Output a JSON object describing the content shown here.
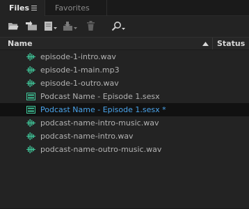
{
  "tabs": {
    "files_label": "Files",
    "favorites_label": "Favorites"
  },
  "toolbar": {
    "icons": [
      "open-folder-icon",
      "import-icon",
      "new-file-dropdown-icon",
      "insert-dropdown-icon",
      "delete-icon",
      "search-dropdown-icon"
    ]
  },
  "list": {
    "name_header": "Name",
    "status_header": "Status",
    "sort_direction": "ascending",
    "files": [
      {
        "label": "episode-1-intro.wav",
        "icon": "waveform-icon",
        "selected": false
      },
      {
        "label": "episode-1-main.mp3",
        "icon": "waveform-icon",
        "selected": false
      },
      {
        "label": "episode-1-outro.wav",
        "icon": "waveform-icon",
        "selected": false
      },
      {
        "label": "Podcast Name - Episode 1.sesx",
        "icon": "multitrack-session-icon",
        "selected": false
      },
      {
        "label": "Podcast Name - Episode 1.sesx *",
        "icon": "multitrack-session-icon",
        "selected": true
      },
      {
        "label": "podcast-name-intro-music.wav",
        "icon": "waveform-icon",
        "selected": false
      },
      {
        "label": "podcast-name-intro.wav",
        "icon": "waveform-icon",
        "selected": false
      },
      {
        "label": "podcast-name-outro-music.wav",
        "icon": "waveform-icon",
        "selected": false
      }
    ]
  },
  "colors": {
    "panel_bg": "#232323",
    "selected_text": "#4aa3ea",
    "icon_green": "#3fc79a"
  }
}
